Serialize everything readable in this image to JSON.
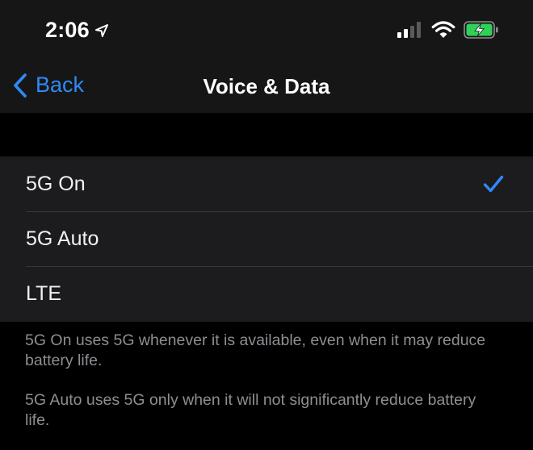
{
  "status_bar": {
    "time": "2:06",
    "icons": [
      "location-arrow-icon",
      "cellular-signal-icon",
      "wifi-icon",
      "battery-charging-icon"
    ]
  },
  "nav": {
    "back_label": "Back",
    "title": "Voice & Data"
  },
  "options": [
    {
      "label": "5G On",
      "selected": true
    },
    {
      "label": "5G Auto",
      "selected": false
    },
    {
      "label": "LTE",
      "selected": false
    }
  ],
  "footer": {
    "notes": [
      "5G On uses 5G whenever it is available, even when it may reduce battery life.",
      "5G Auto uses 5G only when it will not significantly reduce battery life."
    ]
  },
  "colors": {
    "accent": "#2f8af8",
    "battery_green": "#30d158",
    "background": "#000000",
    "chrome": "#161616",
    "group": "#1c1c1e",
    "footer_text": "#8e8e93"
  }
}
